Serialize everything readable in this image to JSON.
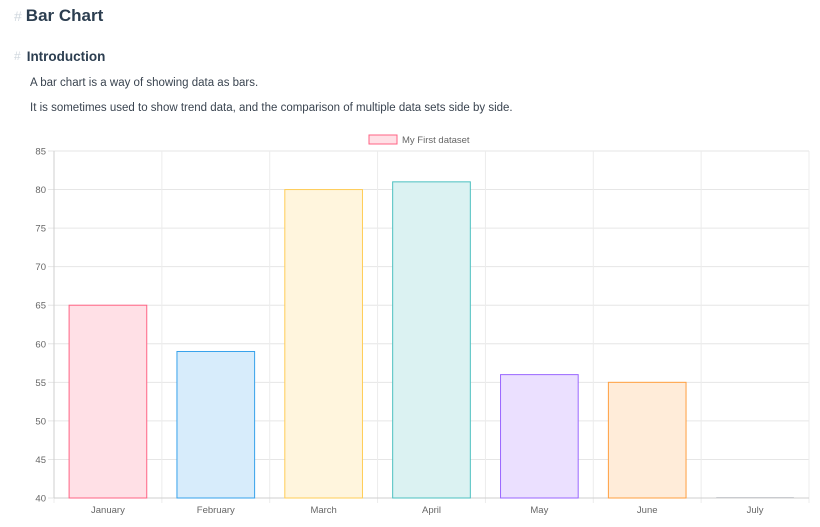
{
  "page": {
    "title": "Bar Chart",
    "section_title": "Introduction",
    "paragraphs": [
      "A bar chart is a way of showing data as bars.",
      "It is sometimes used to show trend data, and the comparison of multiple data sets side by side."
    ]
  },
  "chart_data": {
    "type": "bar",
    "categories": [
      "January",
      "February",
      "March",
      "April",
      "May",
      "June",
      "July"
    ],
    "series": [
      {
        "name": "My First dataset",
        "values": [
          65,
          59,
          80,
          81,
          56,
          55,
          40
        ]
      }
    ],
    "ylim": [
      40,
      85
    ],
    "yticks": [
      40,
      45,
      50,
      55,
      60,
      65,
      70,
      75,
      80,
      85
    ],
    "grid": true,
    "legend": "top-center",
    "bar_fills": [
      "#ffe0e6",
      "#d7ecfb",
      "#fff5dd",
      "#dbf2f2",
      "#ebe0ff",
      "#ffecd9",
      "#f4f5f5"
    ],
    "bar_borders": [
      "#ff6384",
      "#36a2eb",
      "#ffcd56",
      "#4bc0c0",
      "#9966ff",
      "#ff9f40",
      "#c9cbcf"
    ]
  }
}
